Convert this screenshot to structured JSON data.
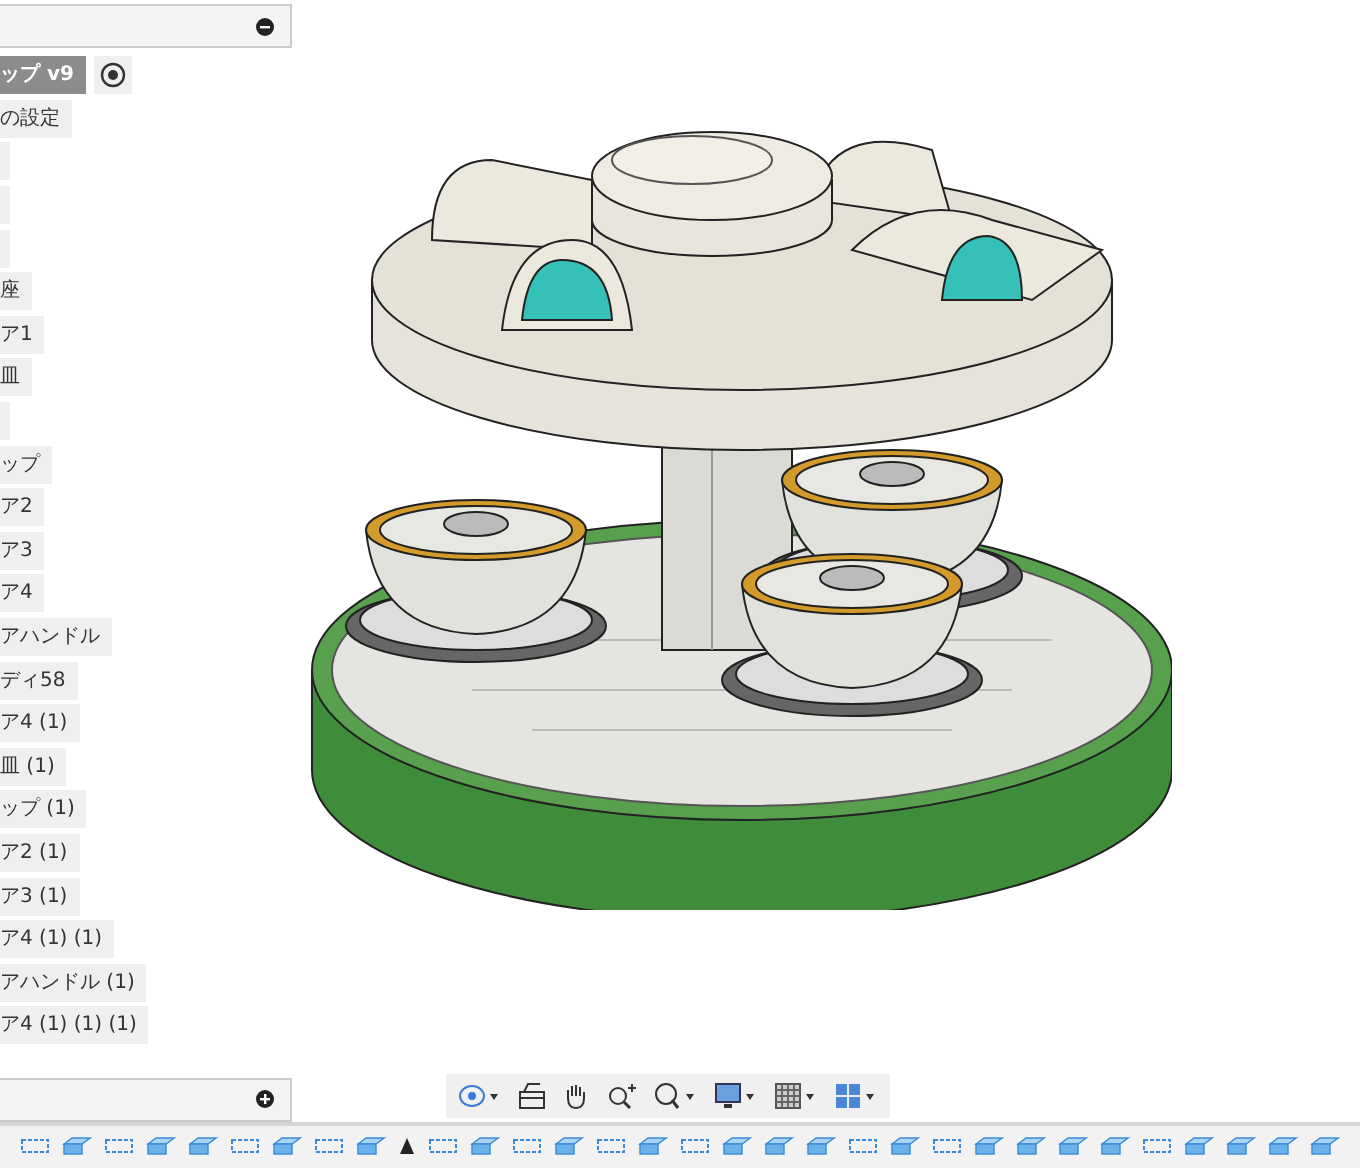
{
  "browser": {
    "items": [
      {
        "kind": "text",
        "label": "ップ v9",
        "selected": true
      },
      {
        "kind": "text",
        "label": "の設定",
        "selected": false
      },
      {
        "kind": "blank",
        "selected": false
      },
      {
        "kind": "blank",
        "selected": false
      },
      {
        "kind": "blank",
        "selected": false
      },
      {
        "kind": "text",
        "label": "座",
        "selected": false
      },
      {
        "kind": "text",
        "label": "ア1",
        "selected": false
      },
      {
        "kind": "text",
        "label": "皿",
        "selected": false
      },
      {
        "kind": "blank",
        "selected": false
      },
      {
        "kind": "text",
        "label": "ップ",
        "selected": false
      },
      {
        "kind": "text",
        "label": "ア2",
        "selected": false
      },
      {
        "kind": "text",
        "label": "ア3",
        "selected": false
      },
      {
        "kind": "text",
        "label": "ア4",
        "selected": false
      },
      {
        "kind": "text",
        "label": "アハンドル",
        "selected": false
      },
      {
        "kind": "text",
        "label": "ディ58",
        "selected": false
      },
      {
        "kind": "text",
        "label": "ア4 (1)",
        "selected": false
      },
      {
        "kind": "text",
        "label": "皿 (1)",
        "selected": false
      },
      {
        "kind": "text",
        "label": "ップ (1)",
        "selected": false
      },
      {
        "kind": "text",
        "label": "ア2 (1)",
        "selected": false
      },
      {
        "kind": "text",
        "label": "ア3 (1)",
        "selected": false
      },
      {
        "kind": "text",
        "label": "ア4 (1) (1)",
        "selected": false
      },
      {
        "kind": "text",
        "label": "アハンドル (1)",
        "selected": false
      },
      {
        "kind": "text",
        "label": "ア4 (1) (1) (1)",
        "selected": false
      }
    ]
  },
  "timeline": [
    {
      "kind": "sketch"
    },
    {
      "kind": "extrude"
    },
    {
      "kind": "sketch"
    },
    {
      "kind": "extrude"
    },
    {
      "kind": "extrude"
    },
    {
      "kind": "sketch"
    },
    {
      "kind": "extrude"
    },
    {
      "kind": "sketch"
    },
    {
      "kind": "extrude"
    },
    {
      "kind": "marker"
    },
    {
      "kind": "sketch"
    },
    {
      "kind": "extrude"
    },
    {
      "kind": "sketch"
    },
    {
      "kind": "extrude"
    },
    {
      "kind": "sketch"
    },
    {
      "kind": "extrude"
    },
    {
      "kind": "sketch"
    },
    {
      "kind": "extrude"
    },
    {
      "kind": "extrude"
    },
    {
      "kind": "extrude"
    },
    {
      "kind": "sketch"
    },
    {
      "kind": "extrude"
    },
    {
      "kind": "sketch"
    },
    {
      "kind": "extrude"
    },
    {
      "kind": "extrude"
    },
    {
      "kind": "extrude"
    },
    {
      "kind": "extrude"
    },
    {
      "kind": "sketch"
    },
    {
      "kind": "extrude"
    },
    {
      "kind": "extrude"
    },
    {
      "kind": "extrude"
    },
    {
      "kind": "extrude"
    }
  ]
}
